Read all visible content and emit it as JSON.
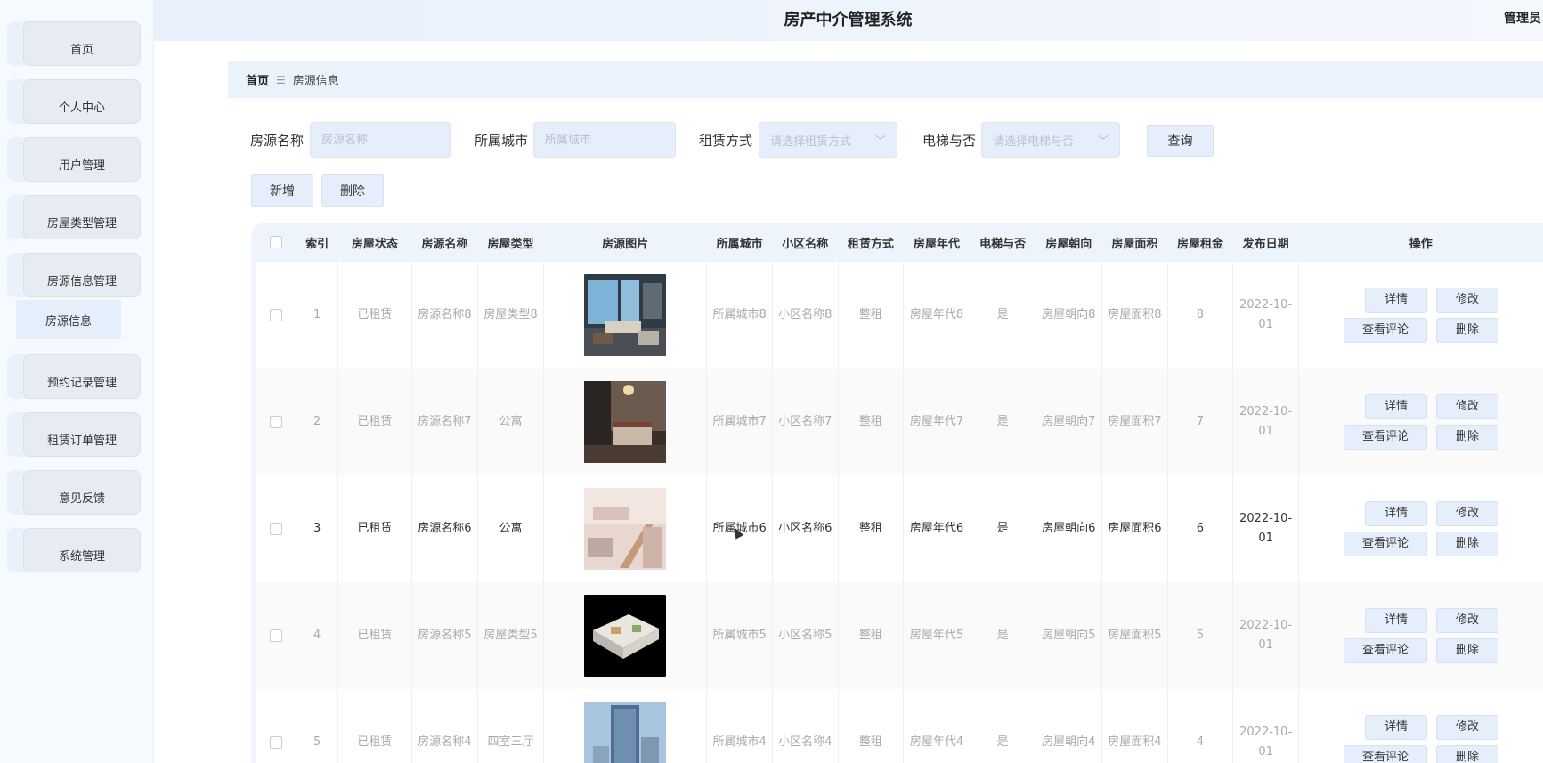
{
  "app": {
    "title": "房产中介管理系统",
    "user": "管理员"
  },
  "sidebar": {
    "items": [
      {
        "label": "首页"
      },
      {
        "label": "个人中心"
      },
      {
        "label": "用户管理"
      },
      {
        "label": "房屋类型管理"
      },
      {
        "label": "房源信息管理"
      },
      {
        "label": "预约记录管理"
      },
      {
        "label": "租赁订单管理"
      },
      {
        "label": "意见反馈"
      },
      {
        "label": "系统管理"
      }
    ],
    "sub_item": "房源信息"
  },
  "breadcrumb": {
    "home": "首页",
    "separator": "☰",
    "current": "房源信息"
  },
  "search": {
    "name_label": "房源名称",
    "name_placeholder": "房源名称",
    "city_label": "所属城市",
    "city_placeholder": "所属城市",
    "rent_label": "租赁方式",
    "rent_placeholder": "请选择租赁方式",
    "elevator_label": "电梯与否",
    "elevator_placeholder": "请选择电梯与否",
    "query_button": "查询"
  },
  "actions": {
    "add": "新增",
    "delete": "删除"
  },
  "table": {
    "headers": [
      "索引",
      "房屋状态",
      "房源名称",
      "房屋类型",
      "房源图片",
      "所属城市",
      "小区名称",
      "租赁方式",
      "房屋年代",
      "电梯与否",
      "房屋朝向",
      "房屋面积",
      "房屋租金",
      "发布日期",
      "操作"
    ],
    "row_actions": {
      "detail": "详情",
      "edit": "修改",
      "comments": "查看评论",
      "delete": "删除"
    },
    "rows": [
      {
        "index": "1",
        "status": "已租赁",
        "name": "房源名称8",
        "type": "房屋类型8",
        "image": "interior-living-room",
        "city": "所属城市8",
        "community": "小区名称8",
        "rent_mode": "整租",
        "age": "房屋年代8",
        "elevator": "是",
        "orientation": "房屋朝向8",
        "area": "房屋面积8",
        "rent": "8",
        "date": "2022-10-01"
      },
      {
        "index": "2",
        "status": "已租赁",
        "name": "房源名称7",
        "type": "公寓",
        "image": "bedroom",
        "city": "所属城市7",
        "community": "小区名称7",
        "rent_mode": "整租",
        "age": "房屋年代7",
        "elevator": "是",
        "orientation": "房屋朝向7",
        "area": "房屋面积7",
        "rent": "7",
        "date": "2022-10-01"
      },
      {
        "index": "3",
        "status": "已租赁",
        "name": "房源名称6",
        "type": "公寓",
        "image": "loft-staircase",
        "city": "所属城市6",
        "community": "小区名称6",
        "rent_mode": "整租",
        "age": "房屋年代6",
        "elevator": "是",
        "orientation": "房屋朝向6",
        "area": "房屋面积6",
        "rent": "6",
        "date": "2022-10-01"
      },
      {
        "index": "4",
        "status": "已租赁",
        "name": "房源名称5",
        "type": "房屋类型5",
        "image": "floor-plan-3d",
        "city": "所属城市5",
        "community": "小区名称5",
        "rent_mode": "整租",
        "age": "房屋年代5",
        "elevator": "是",
        "orientation": "房屋朝向5",
        "area": "房屋面积5",
        "rent": "5",
        "date": "2022-10-01"
      },
      {
        "index": "5",
        "status": "已租赁",
        "name": "房源名称4",
        "type": "四室三厅",
        "image": "building-exterior",
        "city": "所属城市4",
        "community": "小区名称4",
        "rent_mode": "整租",
        "age": "房屋年代4",
        "elevator": "是",
        "orientation": "房屋朝向4",
        "area": "房屋面积4",
        "rent": "4",
        "date": "2022-10-01"
      }
    ]
  }
}
